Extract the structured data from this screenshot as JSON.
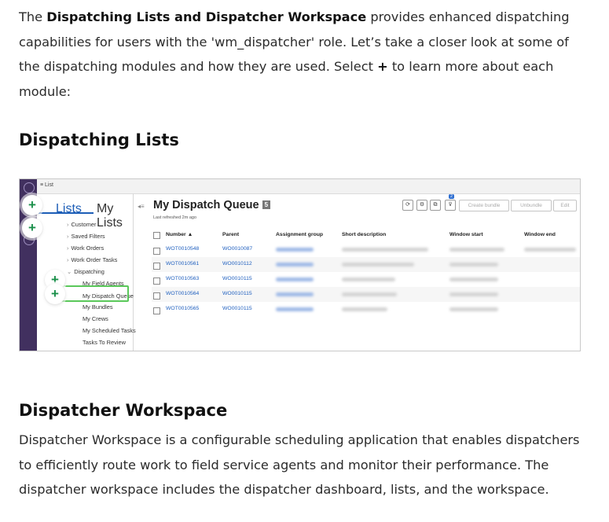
{
  "intro": {
    "p1": "The ",
    "bold": "Dispatching Lists and Dispatcher Workspace",
    "p2": " provides enhanced dispatching capabilities for users with the 'wm_dispatcher' role. Let’s take a closer look at some of the dispatching modules and how they are used. Select ",
    "plus": "+",
    "p3": " to learn more about each module:"
  },
  "heading_lists": "Dispatching Lists",
  "heading_workspace": "Dispatcher Workspace",
  "workspace_text": "Dispatcher Workspace is a configurable scheduling application that enables dispatchers to efficiently route work to field service agents and monitor their performance. The dispatcher workspace includes the dispatcher dashboard, lists, and the workspace.",
  "screenshot": {
    "top_label": "≡ List",
    "tabs": {
      "lists": "Lists",
      "my_lists": "My Lists"
    },
    "sidebar": [
      "Customer",
      "Saved Filters",
      "Work Orders",
      "Work Order Tasks",
      "Dispatching",
      "My Field Agents",
      "My Dispatch Queue",
      "My Bundles",
      "My Crews",
      "My Scheduled Tasks",
      "Tasks To Review"
    ],
    "title": "My Dispatch Queue",
    "badge": "5",
    "subtitle": "Last refreshed 2m ago",
    "filter_count": "2",
    "buttons": {
      "create_bundle": "Create bundle",
      "unbundle": "Unbundle",
      "edit": "Edit"
    },
    "columns": [
      "Number ▲",
      "Parent",
      "Assignment group",
      "Short description",
      "Window start",
      "Window end"
    ],
    "rows": [
      {
        "number": "WOT0010548",
        "parent": "WO0010087"
      },
      {
        "number": "WOT0010561",
        "parent": "WO0010112"
      },
      {
        "number": "WOT0010563",
        "parent": "WO0010115"
      },
      {
        "number": "WOT0010564",
        "parent": "WO0010115"
      },
      {
        "number": "WOT0010565",
        "parent": "WO0010115"
      }
    ],
    "plus_symbol": "+"
  }
}
